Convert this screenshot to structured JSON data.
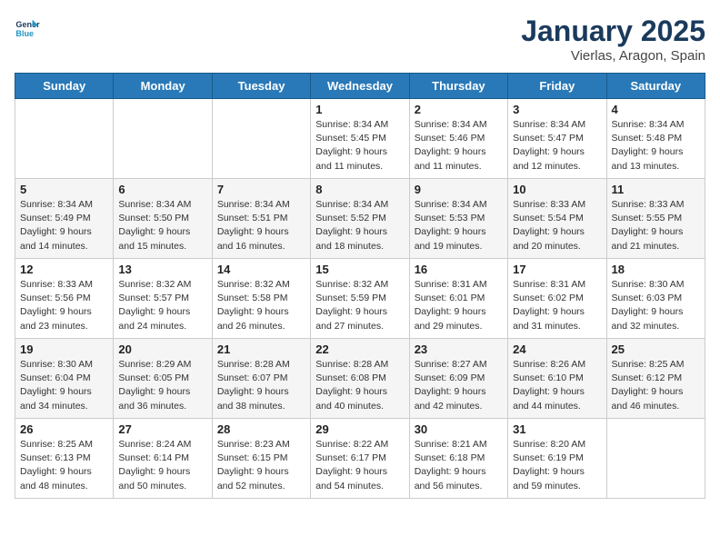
{
  "header": {
    "logo_general": "General",
    "logo_blue": "Blue",
    "title": "January 2025",
    "subtitle": "Vierlas, Aragon, Spain"
  },
  "days_of_week": [
    "Sunday",
    "Monday",
    "Tuesday",
    "Wednesday",
    "Thursday",
    "Friday",
    "Saturday"
  ],
  "weeks": [
    [
      {
        "day": "",
        "info": ""
      },
      {
        "day": "",
        "info": ""
      },
      {
        "day": "",
        "info": ""
      },
      {
        "day": "1",
        "info": "Sunrise: 8:34 AM\nSunset: 5:45 PM\nDaylight: 9 hours\nand 11 minutes."
      },
      {
        "day": "2",
        "info": "Sunrise: 8:34 AM\nSunset: 5:46 PM\nDaylight: 9 hours\nand 11 minutes."
      },
      {
        "day": "3",
        "info": "Sunrise: 8:34 AM\nSunset: 5:47 PM\nDaylight: 9 hours\nand 12 minutes."
      },
      {
        "day": "4",
        "info": "Sunrise: 8:34 AM\nSunset: 5:48 PM\nDaylight: 9 hours\nand 13 minutes."
      }
    ],
    [
      {
        "day": "5",
        "info": "Sunrise: 8:34 AM\nSunset: 5:49 PM\nDaylight: 9 hours\nand 14 minutes."
      },
      {
        "day": "6",
        "info": "Sunrise: 8:34 AM\nSunset: 5:50 PM\nDaylight: 9 hours\nand 15 minutes."
      },
      {
        "day": "7",
        "info": "Sunrise: 8:34 AM\nSunset: 5:51 PM\nDaylight: 9 hours\nand 16 minutes."
      },
      {
        "day": "8",
        "info": "Sunrise: 8:34 AM\nSunset: 5:52 PM\nDaylight: 9 hours\nand 18 minutes."
      },
      {
        "day": "9",
        "info": "Sunrise: 8:34 AM\nSunset: 5:53 PM\nDaylight: 9 hours\nand 19 minutes."
      },
      {
        "day": "10",
        "info": "Sunrise: 8:33 AM\nSunset: 5:54 PM\nDaylight: 9 hours\nand 20 minutes."
      },
      {
        "day": "11",
        "info": "Sunrise: 8:33 AM\nSunset: 5:55 PM\nDaylight: 9 hours\nand 21 minutes."
      }
    ],
    [
      {
        "day": "12",
        "info": "Sunrise: 8:33 AM\nSunset: 5:56 PM\nDaylight: 9 hours\nand 23 minutes."
      },
      {
        "day": "13",
        "info": "Sunrise: 8:32 AM\nSunset: 5:57 PM\nDaylight: 9 hours\nand 24 minutes."
      },
      {
        "day": "14",
        "info": "Sunrise: 8:32 AM\nSunset: 5:58 PM\nDaylight: 9 hours\nand 26 minutes."
      },
      {
        "day": "15",
        "info": "Sunrise: 8:32 AM\nSunset: 5:59 PM\nDaylight: 9 hours\nand 27 minutes."
      },
      {
        "day": "16",
        "info": "Sunrise: 8:31 AM\nSunset: 6:01 PM\nDaylight: 9 hours\nand 29 minutes."
      },
      {
        "day": "17",
        "info": "Sunrise: 8:31 AM\nSunset: 6:02 PM\nDaylight: 9 hours\nand 31 minutes."
      },
      {
        "day": "18",
        "info": "Sunrise: 8:30 AM\nSunset: 6:03 PM\nDaylight: 9 hours\nand 32 minutes."
      }
    ],
    [
      {
        "day": "19",
        "info": "Sunrise: 8:30 AM\nSunset: 6:04 PM\nDaylight: 9 hours\nand 34 minutes."
      },
      {
        "day": "20",
        "info": "Sunrise: 8:29 AM\nSunset: 6:05 PM\nDaylight: 9 hours\nand 36 minutes."
      },
      {
        "day": "21",
        "info": "Sunrise: 8:28 AM\nSunset: 6:07 PM\nDaylight: 9 hours\nand 38 minutes."
      },
      {
        "day": "22",
        "info": "Sunrise: 8:28 AM\nSunset: 6:08 PM\nDaylight: 9 hours\nand 40 minutes."
      },
      {
        "day": "23",
        "info": "Sunrise: 8:27 AM\nSunset: 6:09 PM\nDaylight: 9 hours\nand 42 minutes."
      },
      {
        "day": "24",
        "info": "Sunrise: 8:26 AM\nSunset: 6:10 PM\nDaylight: 9 hours\nand 44 minutes."
      },
      {
        "day": "25",
        "info": "Sunrise: 8:25 AM\nSunset: 6:12 PM\nDaylight: 9 hours\nand 46 minutes."
      }
    ],
    [
      {
        "day": "26",
        "info": "Sunrise: 8:25 AM\nSunset: 6:13 PM\nDaylight: 9 hours\nand 48 minutes."
      },
      {
        "day": "27",
        "info": "Sunrise: 8:24 AM\nSunset: 6:14 PM\nDaylight: 9 hours\nand 50 minutes."
      },
      {
        "day": "28",
        "info": "Sunrise: 8:23 AM\nSunset: 6:15 PM\nDaylight: 9 hours\nand 52 minutes."
      },
      {
        "day": "29",
        "info": "Sunrise: 8:22 AM\nSunset: 6:17 PM\nDaylight: 9 hours\nand 54 minutes."
      },
      {
        "day": "30",
        "info": "Sunrise: 8:21 AM\nSunset: 6:18 PM\nDaylight: 9 hours\nand 56 minutes."
      },
      {
        "day": "31",
        "info": "Sunrise: 8:20 AM\nSunset: 6:19 PM\nDaylight: 9 hours\nand 59 minutes."
      },
      {
        "day": "",
        "info": ""
      }
    ]
  ]
}
